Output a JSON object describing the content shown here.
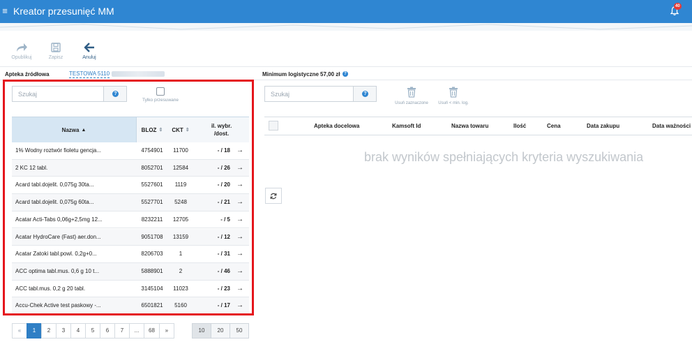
{
  "app": {
    "title": "Kreator przesunięć MM",
    "notification_count": "40"
  },
  "toolbar": {
    "publish_label": "Opublikuj",
    "save_label": "Zapisz",
    "cancel_label": "Anuluj"
  },
  "source": {
    "label": "Apteka źródłowa",
    "value": "TESTOWA 5110"
  },
  "minimum": {
    "label": "Minimum logistyczne",
    "value": "57,00 zł"
  },
  "left_panel": {
    "search_placeholder": "Szukaj",
    "only_moved_label": "Tylko przesuwane",
    "columns": {
      "name": "Nazwa",
      "bloz": "BLOZ",
      "ckt": "CKT",
      "qty_line1": "il. wybr.",
      "qty_line2": "/dost."
    },
    "rows": [
      {
        "name": "1% Wodny roztwór fioletu gencja...",
        "bloz": "4754901",
        "ckt": "11700",
        "qty": "- / 18"
      },
      {
        "name": "2 KC 12 tabl.",
        "bloz": "8052701",
        "ckt": "12584",
        "qty": "- / 26"
      },
      {
        "name": "Acard tabl.dojelit. 0,075g 30ta...",
        "bloz": "5527601",
        "ckt": "1119",
        "qty": "- / 20"
      },
      {
        "name": "Acard tabl.dojelit. 0,075g 60ta...",
        "bloz": "5527701",
        "ckt": "5248",
        "qty": "- / 21"
      },
      {
        "name": "Acatar Acti-Tabs 0,06g+2,5mg 12...",
        "bloz": "8232211",
        "ckt": "12705",
        "qty": "- / 5"
      },
      {
        "name": "Acatar HydroCare (Fast) aer.don...",
        "bloz": "9051708",
        "ckt": "13159",
        "qty": "- / 12"
      },
      {
        "name": "Acatar Zatoki tabl.powl. 0,2g+0...",
        "bloz": "8206703",
        "ckt": "1",
        "qty": "- / 31"
      },
      {
        "name": "ACC optima tabl.mus. 0,6 g 10 t...",
        "bloz": "5888901",
        "ckt": "2",
        "qty": "- / 46"
      },
      {
        "name": "ACC tabl.mus. 0,2 g 20 tabl.",
        "bloz": "3145104",
        "ckt": "11023",
        "qty": "- / 23"
      },
      {
        "name": "Accu-Chek Active test paskowy -...",
        "bloz": "6501821",
        "ckt": "5160",
        "qty": "- / 17"
      }
    ],
    "pagination": {
      "prev": "«",
      "pages": [
        "1",
        "2",
        "3",
        "4",
        "5",
        "6",
        "7",
        "...",
        "68"
      ],
      "next": "»",
      "active_page": "1"
    },
    "page_sizes": [
      "10",
      "20",
      "50"
    ],
    "active_page_size": "10"
  },
  "right_panel": {
    "search_placeholder": "Szukaj",
    "delete_selected_label": "Usuń zaznaczone",
    "delete_min_label": "Usuń < min. log.",
    "columns": {
      "pharmacy": "Apteka docelowa",
      "kamsoft_id": "Kamsoft Id",
      "product_name": "Nazwa towaru",
      "quantity": "Ilość",
      "price": "Cena",
      "purchase_date": "Data zakupu",
      "expiry_date": "Data ważności"
    },
    "empty_message": "brak wyników spełniających kryteria wyszukiwania"
  },
  "colors": {
    "brand_blue": "#2f86d2",
    "highlight_red": "#e5161c",
    "header_blue": "#d9e8f4"
  }
}
